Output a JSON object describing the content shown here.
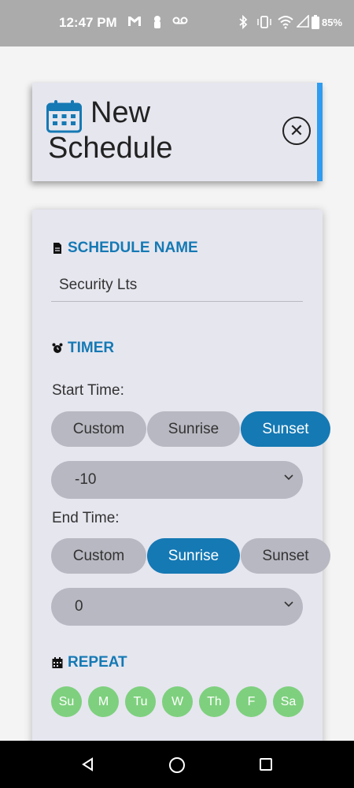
{
  "status_bar": {
    "time": "12:47 PM",
    "battery": "85%",
    "icons": [
      "gmail-icon",
      "lock-icon",
      "voicemail-icon",
      "bluetooth-icon",
      "vibrate-icon",
      "wifi-icon",
      "signal-icon",
      "battery-icon"
    ]
  },
  "header": {
    "title": "New Schedule",
    "accent_color": "#2f9cf0"
  },
  "form": {
    "schedule_name": {
      "label": "SCHEDULE NAME",
      "value": "Security Lts"
    },
    "timer": {
      "label": "TIMER",
      "start_time": {
        "label": "Start Time:",
        "options": [
          "Custom",
          "Sunrise",
          "Sunset"
        ],
        "selected": "Sunset",
        "offset_value": "-10"
      },
      "end_time": {
        "label": "End Time:",
        "options": [
          "Custom",
          "Sunrise",
          "Sunset"
        ],
        "selected": "Sunrise",
        "offset_value": "0"
      }
    },
    "repeat": {
      "label": "REPEAT",
      "days": [
        "Su",
        "M",
        "Tu",
        "W",
        "Th",
        "F",
        "Sa"
      ]
    }
  },
  "colors": {
    "accent": "#1579b4",
    "day_active": "#7ed07e"
  }
}
